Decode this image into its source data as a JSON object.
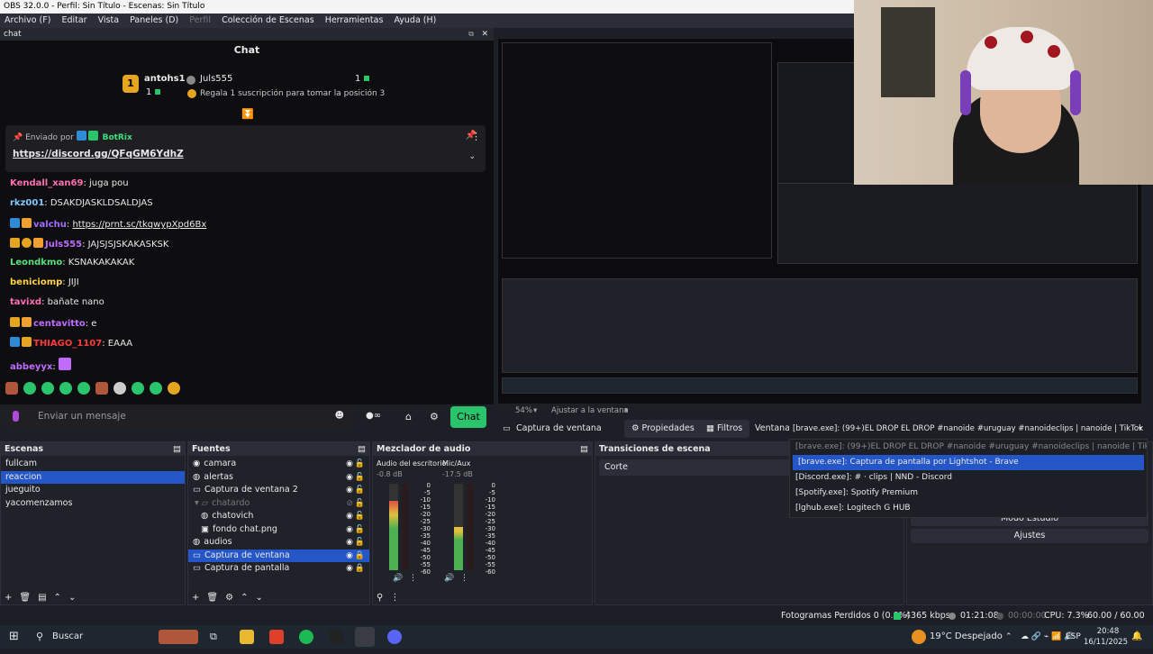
{
  "window": {
    "title": "OBS 32.0.0 - Perfil: Sin Título - Escenas: Sin Título"
  },
  "menu": [
    "Archivo (F)",
    "Editar",
    "Vista",
    "Paneles (D)",
    "Perfil",
    "Colección de Escenas",
    "Herramientas",
    "Ayuda (H)"
  ],
  "chat_dock": {
    "title": "chat",
    "heading": "Chat",
    "leader1": {
      "rank": "1",
      "name": "antohs1",
      "count": "1"
    },
    "leader2": {
      "name": "Juls555",
      "count": "1",
      "text": "Regala 1 suscripción para tomar la posición 3"
    },
    "pinned": {
      "sent_by": "Enviado por",
      "bot": "BotRix",
      "link": "https://discord.gg/QFqGM6YdhZ"
    },
    "messages": [
      {
        "user": "Kendall_xan69",
        "color": "#ff6fb5",
        "text": ": juga pou"
      },
      {
        "user": "rkz001",
        "color": "#7ec8ff",
        "text": ": DSAKDJASKLDSALDJAS"
      },
      {
        "user": "valchu",
        "color": "#a46bff",
        "text": ": ",
        "link": "https://prnt.sc/tkqwypXpd6Bx"
      },
      {
        "user": "Juls555",
        "color": "#c06bff",
        "text": ": JAJSJSJSKAKASKSK"
      },
      {
        "user": "Leondkmo",
        "color": "#59e07d",
        "text": ": KSNAKAKAKAK"
      },
      {
        "user": "beniciomp",
        "color": "#ffd24a",
        "text": ": JIJI"
      },
      {
        "user": "tavixd",
        "color": "#ff6fb5",
        "text": ": bañate nano"
      },
      {
        "user": "centavitto",
        "color": "#c06bff",
        "text": ": e"
      },
      {
        "user": "THIAGO_1107",
        "color": "#ff3b3b",
        "text": ": EAAA"
      },
      {
        "user": "abbeyyx",
        "color": "#c06bff",
        "text": ":"
      }
    ],
    "input_placeholder": "Enviar un mensaje",
    "send_label": "Chat"
  },
  "preview_bar": {
    "zoom": "54%",
    "fit": "Ajustar a la ventana"
  },
  "source_bar": {
    "source": "Captura de ventana",
    "properties": "Propiedades",
    "filters": "Filtros",
    "window_label": "Ventana",
    "window_value": "[brave.exe]: (99+)EL DROP EL DROP #nanoide #uruguay #nanoideclips | nanoide | TikTok - Bra"
  },
  "dropdown_items": [
    "[brave.exe]: (99+)EL DROP EL DROP #nanoide #uruguay #nanoideclips | nanoide | TikTok - Brave",
    "[brave.exe]: Captura de pantalla por Lightshot - Brave",
    "[Discord.exe]: # · clips | NND - Discord",
    "[Spotify.exe]: Spotify Premium",
    "[lghub.exe]: Logitech G HUB"
  ],
  "scenes": {
    "title": "Escenas",
    "items": [
      "fullcam",
      "reaccion",
      "jueguito",
      "yacomenzamos"
    ],
    "selected": 1
  },
  "sources": {
    "title": "Fuentes",
    "items": [
      {
        "label": "camara",
        "indent": 0
      },
      {
        "label": "alertas",
        "indent": 0
      },
      {
        "label": "Captura de ventana 2",
        "indent": 0
      },
      {
        "label": "chatardo",
        "indent": 1
      },
      {
        "label": "chatovich",
        "indent": 2
      },
      {
        "label": "fondo chat.png",
        "indent": 2
      },
      {
        "label": "audios",
        "indent": 0
      },
      {
        "label": "Captura de ventana",
        "indent": 0
      },
      {
        "label": "Captura de pantalla",
        "indent": 0
      }
    ],
    "selected": 7
  },
  "mixer": {
    "title": "Mezclador de audio",
    "ch1": {
      "name": "Audio del escritorio",
      "db": "-0.8 dB",
      "level": 0.8
    },
    "ch2": {
      "name": "Mic/Aux",
      "db": "-17.5 dB",
      "level": 0.5
    },
    "scale": [
      "0",
      "-5",
      "-10",
      "-15",
      "-20",
      "-25",
      "-30",
      "-35",
      "-40",
      "-45",
      "-50",
      "-55",
      "-60"
    ]
  },
  "transitions": {
    "title": "Transiciones de escena",
    "value": "Corte"
  },
  "controls": {
    "studio": "Modo Estudio",
    "settings": "Ajustes"
  },
  "status": {
    "dropped": "Fotogramas Perdidos 0 (0.0%)",
    "bitrate": "4365 kbps",
    "live_time": "01:21:08",
    "rec_time": "00:00:00",
    "cpu": "CPU: 7.3%",
    "fps": "60.00 / 60.00 FPS"
  },
  "taskbar": {
    "search": "Buscar",
    "weather": "19°C  Despejado",
    "lang": "ESP",
    "time": "20:48",
    "date": "16/11/2025"
  }
}
